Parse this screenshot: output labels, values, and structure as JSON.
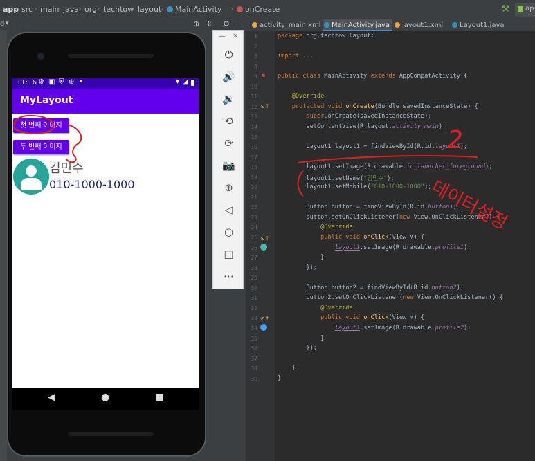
{
  "breadcrumb": [
    "app",
    "src",
    "main",
    "java",
    "org",
    "techtow",
    "layout",
    "MainActivity",
    "onCreate"
  ],
  "left_toolbar_label": "d",
  "tabs": [
    {
      "label": "activity_main.xml",
      "active": false,
      "color": "#e8a33d"
    },
    {
      "label": "MainActivity.java",
      "active": true,
      "color": "#3592c4"
    },
    {
      "label": "layout1.xml",
      "active": false,
      "color": "#e8a33d"
    },
    {
      "label": "Layout1.java",
      "active": false,
      "color": "#3592c4"
    }
  ],
  "run_config": "ap",
  "phone": {
    "status_time": "11:16",
    "app_title": "MyLayout",
    "button1": "첫 번째 이미지",
    "button2": "두 번째 이미지",
    "name": "김민수",
    "mobile": "010-1000-1000"
  },
  "emulator_toolbar": [
    {
      "name": "power-icon",
      "glyph": "⏻"
    },
    {
      "name": "volume-up-icon",
      "glyph": "🔊"
    },
    {
      "name": "volume-down-icon",
      "glyph": "🔉"
    },
    {
      "name": "rotate-left-icon",
      "glyph": "⟲"
    },
    {
      "name": "rotate-right-icon",
      "glyph": "⟳"
    },
    {
      "name": "camera-icon",
      "glyph": "📷"
    },
    {
      "name": "zoom-icon",
      "glyph": "⊕"
    },
    {
      "name": "back-icon",
      "glyph": "◁"
    },
    {
      "name": "home-icon",
      "glyph": "○"
    },
    {
      "name": "overview-icon",
      "glyph": "□"
    },
    {
      "name": "more-icon",
      "glyph": "⋯"
    }
  ],
  "annotations": {
    "circle_number": "2",
    "korean_note": "데이터설정"
  },
  "code_lines": [
    {
      "n": "1",
      "html": "<span class='kw'>package</span> org.techtow.layout;"
    },
    {
      "n": "2",
      "html": ""
    },
    {
      "n": "3",
      "html": "<span class='kw'>import</span> <span class='cmt'>...</span>"
    },
    {
      "n": "8",
      "html": ""
    },
    {
      "n": "9",
      "html": "<span class='kw'>public class</span> MainActivity <span class='kw'>extends</span> AppCompatActivity {"
    },
    {
      "n": "10",
      "html": ""
    },
    {
      "n": "11",
      "html": "    <span class='ann'>@Override</span>"
    },
    {
      "n": "12",
      "html": "    <span class='kw'>protected void</span> <span class='mth'>onCreate</span>(Bundle savedInstanceState) {"
    },
    {
      "n": "13",
      "html": "        <span class='kw'>super</span>.onCreate(savedInstanceState);"
    },
    {
      "n": "14",
      "html": "        setContentView(R.layout.<span class='fld'>activity_main</span>);"
    },
    {
      "n": "15",
      "html": ""
    },
    {
      "n": "16",
      "html": "        Layout1 layout1 = findViewById(R.id.<span class='fld'>layout1</span>);"
    },
    {
      "n": "17",
      "html": ""
    },
    {
      "n": "18",
      "html": "        layout1.setImage(R.drawable.<span class='fld'>ic_launcher_foreground</span>);"
    },
    {
      "n": "19",
      "html": "        layout1.setName(<span class='str'>\"김민수\"</span>);"
    },
    {
      "n": "20",
      "html": "        layout1.setMobile(<span class='str'>\"010-1000-1000\"</span>);"
    },
    {
      "n": "21",
      "html": ""
    },
    {
      "n": "22",
      "html": "        Button button = findViewById(R.id.<span class='fld'>button</span>);"
    },
    {
      "n": "23",
      "html": "        button.setOnClickListener(<span class='kw'>new</span> View.OnClickListener() {"
    },
    {
      "n": "24",
      "html": "            <span class='ann'>@Override</span>"
    },
    {
      "n": "25",
      "html": "            <span class='kw'>public void</span> <span class='mth'>onClick</span>(View v) {"
    },
    {
      "n": "26",
      "html": "                <span class='fld ul'>layout1</span>.setImage(R.drawable.<span class='fld'>profile1</span>);"
    },
    {
      "n": "27",
      "html": "            }"
    },
    {
      "n": "28",
      "html": "        });"
    },
    {
      "n": "29",
      "html": ""
    },
    {
      "n": "30",
      "html": "        Button button2 = findViewById(R.id.<span class='fld'>button2</span>);"
    },
    {
      "n": "31",
      "html": "        button2.setOnClickListener(<span class='kw'>new</span> View.OnClickListener() {"
    },
    {
      "n": "32",
      "html": "            <span class='ann'>@Override</span>"
    },
    {
      "n": "33",
      "html": "            <span class='kw'>public void</span> <span class='mth'>onClick</span>(View v) {"
    },
    {
      "n": "34",
      "html": "                <span class='fld ul'>layout1</span>.setImage(R.drawable.<span class='fld'>profile2</span>);"
    },
    {
      "n": "35",
      "html": "            }"
    },
    {
      "n": "36",
      "html": "        });"
    },
    {
      "n": "37",
      "html": ""
    },
    {
      "n": "38",
      "html": "    }"
    },
    {
      "n": "39",
      "html": "}"
    }
  ]
}
